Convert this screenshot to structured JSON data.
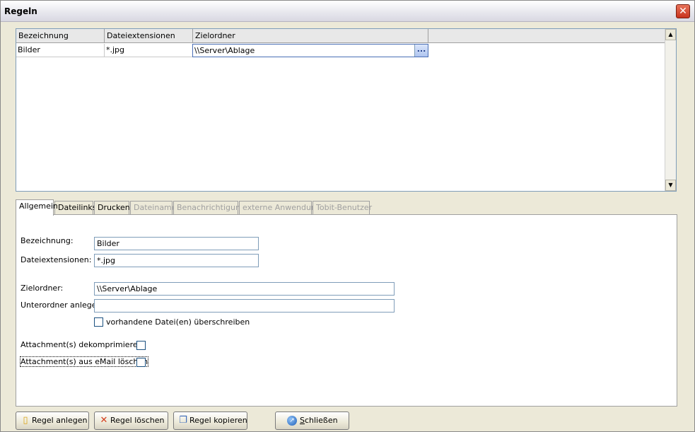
{
  "window": {
    "title": "Regeln",
    "close_glyph": "✕"
  },
  "grid": {
    "columns": [
      "Bezeichnung",
      "Dateiextensionen",
      "Zielordner"
    ],
    "rows": [
      {
        "bezeichnung": "Bilder",
        "extensionen": "*.jpg",
        "zielordner": "\\\\Server\\Ablage",
        "browse": "..."
      }
    ],
    "scroll_up": "▲",
    "scroll_down": "▼"
  },
  "tabs": [
    {
      "label": "Allgemein",
      "active": true
    },
    {
      "label": "Dateilinks"
    },
    {
      "label": "Drucken"
    },
    {
      "label": "Dateiname",
      "disabled": true
    },
    {
      "label": "Benachrichtigung",
      "disabled": true
    },
    {
      "label": "externe Anwendung",
      "disabled": true
    },
    {
      "label": "Tobit-Benutzer",
      "disabled": true
    }
  ],
  "form": {
    "bezeichnung_label": "Bezeichnung:",
    "bezeichnung_value": "Bilder",
    "extensionen_label": "Dateiextensionen:",
    "extensionen_value": "*.jpg",
    "zielordner_label": "Zielordner:",
    "zielordner_value": "\\\\Server\\Ablage",
    "unterordner_label": "Unterordner anlegen:",
    "unterordner_value": "",
    "overwrite_label": "vorhandene Datei(en) überschreiben",
    "dekomprimieren_label": "Attachment(s) dekomprimieren",
    "loeschen_label": "Attachment(s) aus eMail löschen"
  },
  "buttons": {
    "anlegen": "Regel anlegen",
    "loeschen": "Regel löschen",
    "kopieren": "Regel kopieren",
    "schliessen_first": "S",
    "schliessen_rest": "chließen",
    "icon_anlegen": "new-rule-icon",
    "icon_loeschen": "delete-x-icon",
    "icon_kopieren": "copy-icon",
    "icon_schliessen": "close-arrow-icon"
  }
}
